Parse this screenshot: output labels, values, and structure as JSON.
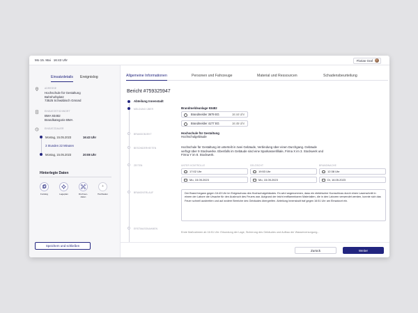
{
  "topbar": {
    "date": "Mo 15. Mai",
    "time": "16:43 Uhr",
    "user": "Florian Graf"
  },
  "sidebar": {
    "tabs": [
      "Einsatzdetails",
      "Ereignislog"
    ],
    "address": {
      "label": "ADRESSE",
      "lines": [
        "Hochschule für Gestaltung",
        "Bahnhofsplatz",
        "73525 Schwäbisch Gmünd"
      ]
    },
    "keyword": {
      "label": "EINSATZSTICHWORT",
      "lines": [
        "BMA 93482",
        "Brandkategorie BMA"
      ]
    },
    "timeline": {
      "label": "EINSATZDAUER",
      "start": {
        "date": "Montag, 15.05.2023",
        "time": "16:43 Uhr"
      },
      "duration": "3 Stunden 22 Minuten",
      "end": {
        "date": "Montag, 15.05.2023",
        "time": "20:08 Uhr"
      }
    },
    "history": {
      "title": "Hinterlegte Daten",
      "items": [
        "Funklog",
        "Lageplan",
        "Drohnen-daten",
        "Hochladen"
      ]
    },
    "save_label": "Speichern und schließen"
  },
  "main": {
    "tabs": [
      "Allgemeine Informationen",
      "Personen und Fahrzeuge",
      "Material und Ressourcen",
      "Schadensbeurteilung"
    ],
    "report_title": "Bericht #759325947",
    "department": "Abteilung Innenstadt",
    "alarm": {
      "label": "MELDUNG ÜBER",
      "title": "Brandmeldeanlage 93482",
      "detectors": [
        {
          "name": "Brandmelder 3679 EG",
          "time": "16:44 Uhr"
        },
        {
          "name": "Brandmelder 4177 EG",
          "time": "16:45 Uhr"
        }
      ]
    },
    "object": {
      "label": "BRANDOBJEKT",
      "title": "Hochschule für Gestaltung",
      "subtitle": "Hochschulgebäude"
    },
    "description": {
      "label": "BESONDERHEITEN",
      "lines": [
        "Hochschule für Gestaltung ist unterteilt in zwei Gebäude, Verbindung über einen Durchgang. Gebäude",
        "verfügt über 9 Stockwerke. Ebenfalls im Gebäude sind eine Sparkassenfiliale, Firma X im 3. Stockwerk und",
        "Firma Y im 8. Stockwerk."
      ]
    },
    "times": {
      "label": "ZEITEN",
      "columns": [
        "UNTER KONTROLLE",
        "GELÖSCHT",
        "BRANDWACHE"
      ],
      "clock": [
        "17:02 Uhr",
        "19:53 Uhr",
        "12:38 Uhr"
      ],
      "dates": [
        "Mo, 15.05.2023",
        "Mo, 15.05.2023",
        "Di, 16.05.2023"
      ]
    },
    "course": {
      "label": "BRANDVERLAUF",
      "text": "Der Brand begann gegen 16:43 Uhr im Erdgeschoss des Hochschulgebäudes. Es wird angenommen, dass ein elektrischer Kurzschluss durch einen Laserschnitt in einem der Labore die Ursache für den Ausbruch des Feuers war. Aufgrund der leicht entflammbaren Materialien, die in den Laboren verwendet werden, konnte sich das Feuer schnell ausbreiten und auf andere Bereiche des Gebäudes übergreifen. Abteilung Innenstadt traf gegen 16:51 Uhr am Einsatzort ein."
    },
    "measures": {
      "label": "ERSTMASSNAHMEN",
      "text": "Erste Maßnahmen ab 16:51 Uhr: Erkundung der Lage, Sicherung des Gebäudes und Aufbau der Wasserversorgung..."
    },
    "cancel_label": "Zurück",
    "next_label": "Weiter"
  }
}
